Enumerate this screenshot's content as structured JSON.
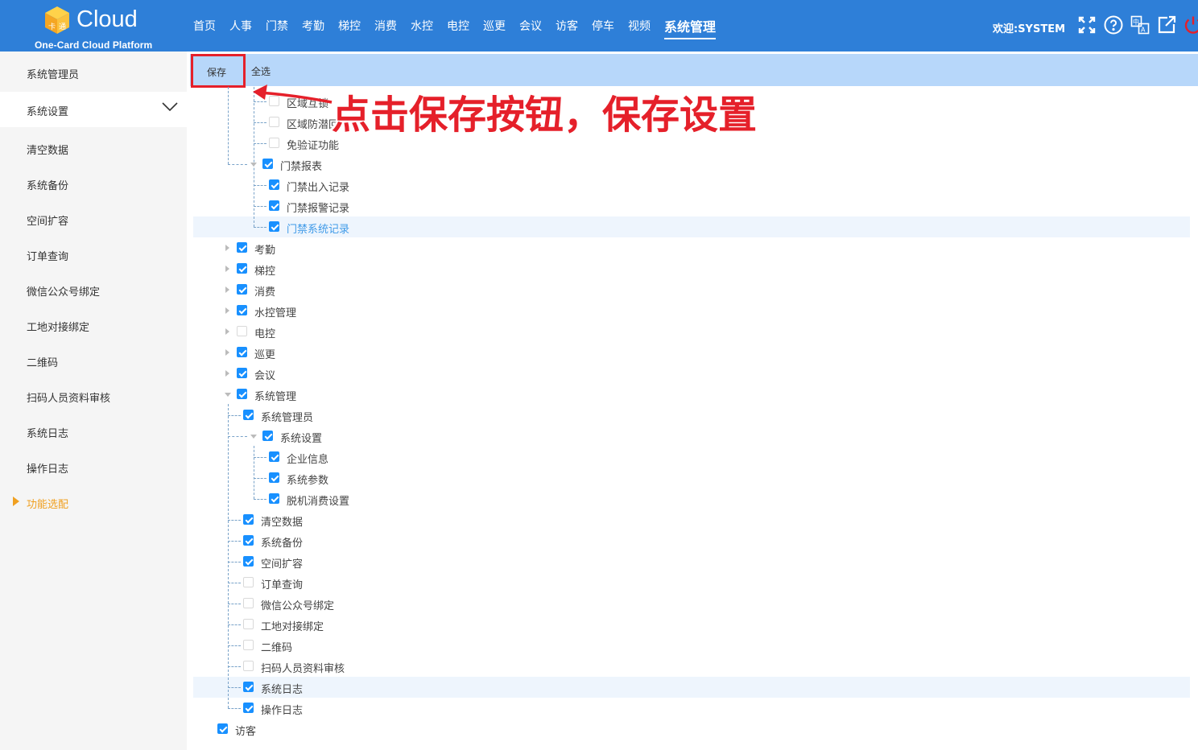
{
  "brand": {
    "name": "Cloud",
    "subtitle": "One-Card Cloud Platform"
  },
  "nav": [
    "首页",
    "人事",
    "门禁",
    "考勤",
    "梯控",
    "消费",
    "水控",
    "电控",
    "巡更",
    "会议",
    "访客",
    "停车",
    "视频",
    "系统管理"
  ],
  "nav_active": "系统管理",
  "welcome": "欢迎:SYSTEM",
  "top_icons": [
    "fullscreen-icon",
    "help-icon",
    "language-icon",
    "external-link-icon",
    "power-icon"
  ],
  "sidebar": {
    "items": [
      {
        "label": "系统管理员"
      },
      {
        "label": "系统设置"
      },
      {
        "label": "清空数据"
      },
      {
        "label": "系统备份"
      },
      {
        "label": "空间扩容"
      },
      {
        "label": "订单查询"
      },
      {
        "label": "微信公众号绑定"
      },
      {
        "label": "工地对接绑定"
      },
      {
        "label": "二维码"
      },
      {
        "label": "扫码人员资料审核"
      },
      {
        "label": "系统日志"
      },
      {
        "label": "操作日志"
      },
      {
        "label": "功能选配"
      }
    ]
  },
  "toolbar": {
    "save": "保存",
    "select_all": "全选"
  },
  "annotation": "点击保存按钮，保存设置",
  "tree": [
    {
      "label": "区域互锁",
      "checked": false
    },
    {
      "label": "区域防潜回",
      "checked": false
    },
    {
      "label": "免验证功能",
      "checked": false
    },
    {
      "label": "门禁报表",
      "checked": true
    },
    {
      "label": "门禁出入记录",
      "checked": true
    },
    {
      "label": "门禁报警记录",
      "checked": true
    },
    {
      "label": "门禁系统记录",
      "checked": true
    },
    {
      "label": "考勤",
      "checked": true
    },
    {
      "label": "梯控",
      "checked": true
    },
    {
      "label": "消费",
      "checked": true
    },
    {
      "label": "水控管理",
      "checked": true
    },
    {
      "label": "电控",
      "checked": false
    },
    {
      "label": "巡更",
      "checked": true
    },
    {
      "label": "会议",
      "checked": true
    },
    {
      "label": "系统管理",
      "checked": true
    },
    {
      "label": "系统管理员",
      "checked": true
    },
    {
      "label": "系统设置",
      "checked": true
    },
    {
      "label": "企业信息",
      "checked": true
    },
    {
      "label": "系统参数",
      "checked": true
    },
    {
      "label": "脱机消费设置",
      "checked": true
    },
    {
      "label": "清空数据",
      "checked": true
    },
    {
      "label": "系统备份",
      "checked": true
    },
    {
      "label": "空间扩容",
      "checked": true
    },
    {
      "label": "订单查询",
      "checked": false
    },
    {
      "label": "微信公众号绑定",
      "checked": false
    },
    {
      "label": "工地对接绑定",
      "checked": false
    },
    {
      "label": "二维码",
      "checked": false
    },
    {
      "label": "扫码人员资料审核",
      "checked": false
    },
    {
      "label": "系统日志",
      "checked": true
    },
    {
      "label": "操作日志",
      "checked": true
    },
    {
      "label": "访客",
      "checked": true
    }
  ]
}
